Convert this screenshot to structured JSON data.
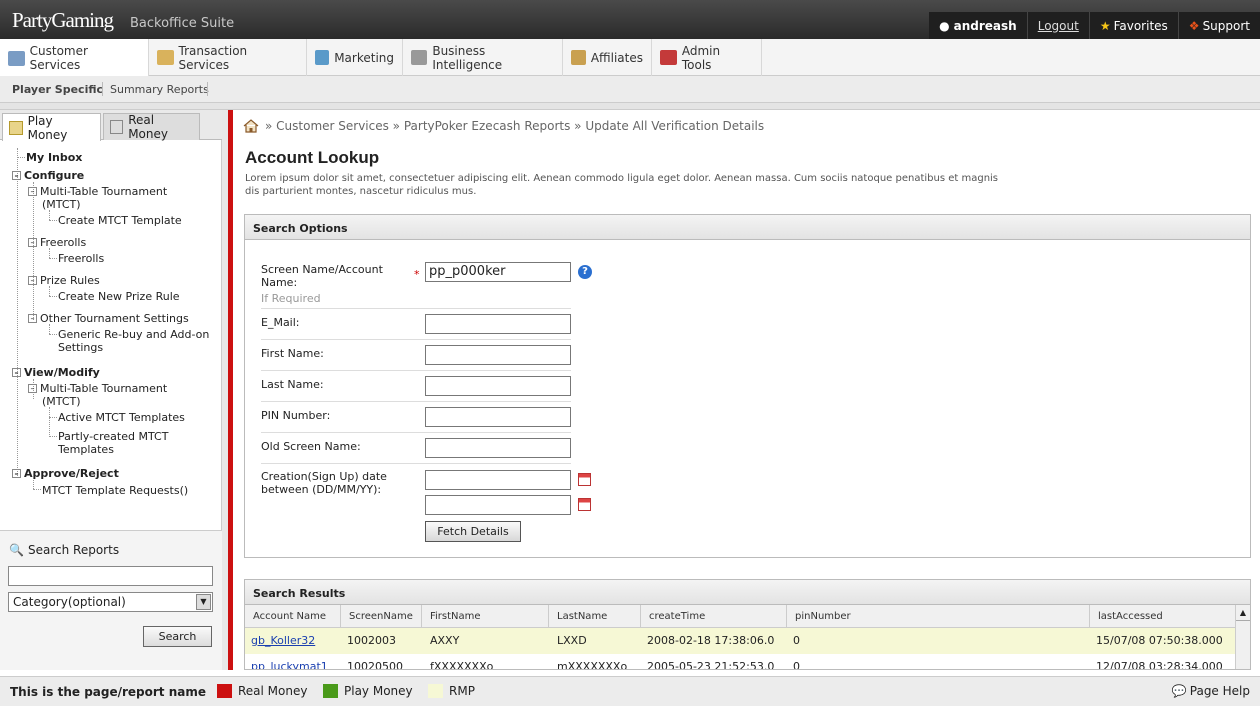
{
  "app": {
    "logo": "PartyGaming",
    "suite": "Backoffice Suite"
  },
  "user": {
    "name": "andreash",
    "logout": "Logout",
    "favorites": "Favorites",
    "support": "Support"
  },
  "mainnav": [
    "Customer Services",
    "Transaction Services",
    "Marketing",
    "Business Intelligence",
    "Affiliates",
    "Admin Tools"
  ],
  "subnav": {
    "player": "Player Specific",
    "summary": "Summary Reports"
  },
  "sidetabs": {
    "play": "Play Money",
    "real": "Real Money"
  },
  "tree": {
    "inbox": "My Inbox",
    "configure": "Configure",
    "mtct": "Multi-Table Tournament",
    "mtct_abbr": "(MTCT)",
    "create_mtct": "Create MTCT Template",
    "freerolls": "Freerolls",
    "freerolls_child": "Freerolls",
    "prize": "Prize Rules",
    "create_prize": "Create New Prize Rule",
    "other": "Other Tournament Settings",
    "rebuy1": "Generic Re-buy and Add-on",
    "rebuy2": "Settings",
    "view": "View/Modify",
    "mtct2": "Multi-Table Tournament",
    "mtct2_abbr": "(MTCT)",
    "active": "Active MTCT Templates",
    "partly1": "Partly-created MTCT",
    "partly2": "Templates",
    "approve": "Approve/Reject",
    "requests": "MTCT Template Requests()"
  },
  "search_reports": {
    "title": "Search Reports",
    "input": "",
    "category": "Category(optional)",
    "button": "Search"
  },
  "breadcrumb": "» Customer Services » PartyPoker Ezecash Reports » Update All Verification Details",
  "page": {
    "title": "Account Lookup",
    "description": "Lorem ipsum dolor sit amet, consectetuer adipiscing elit. Aenean commodo ligula eget dolor. Aenean massa. Cum sociis natoque penatibus et magnis dis parturient montes, nascetur ridiculus mus."
  },
  "search_options": {
    "heading": "Search Options",
    "screen_name_label": "Screen Name/Account Name:",
    "screen_name_hint": "If Required",
    "screen_name_value": "pp_p000ker",
    "email_label": "E_Mail:",
    "first_label": "First Name:",
    "last_label": "Last Name:",
    "pin_label": "PIN Number:",
    "old_label": "Old Screen Name:",
    "date_label": "Creation(Sign Up) date between (DD/MM/YY):",
    "fetch": "Fetch Details"
  },
  "results": {
    "heading": "Search Results",
    "columns": [
      "Account Name",
      "ScreenName",
      "FirstName",
      "LastName",
      "createTime",
      "pinNumber",
      "lastAccessed"
    ],
    "rows": [
      [
        "gb_Koller32",
        "1002003",
        "AXXY",
        "LXXD",
        "2008-02-18 17:38:06.0",
        "0",
        "15/07/08 07:50:38.000"
      ],
      [
        "pp_luckymat1",
        "10020500",
        "fXXXXXXXo",
        "mXXXXXXXo",
        "2005-05-23 21:52:53.0",
        "0",
        "12/07/08 03:28:34.000"
      ]
    ]
  },
  "footer": {
    "page_name": "This is the page/report name",
    "legend": [
      "Real Money",
      "Play Money",
      "RMP"
    ],
    "colors": [
      "#cc1010",
      "#4a9a1a",
      "#f6f8d5"
    ],
    "help": "Page Help"
  }
}
